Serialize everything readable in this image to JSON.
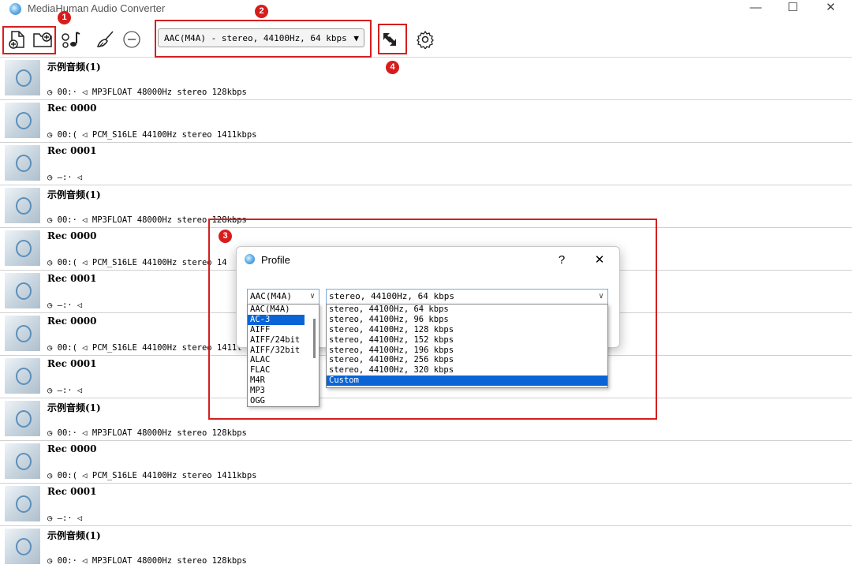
{
  "window": {
    "title": "MediaHuman Audio Converter",
    "minimize": "—",
    "maximize": "☐",
    "close": "✕"
  },
  "toolbar": {
    "profile_value": "AAC(M4A) - stereo, 44100Hz, 64 kbps",
    "icons": [
      "add-file-icon",
      "add-folder-icon",
      "music-note-icon",
      "broom-icon",
      "minus-circle-icon",
      "convert-icon",
      "gear-icon"
    ]
  },
  "markers": {
    "m1": "1",
    "m2": "2",
    "m3": "3",
    "m4": "4"
  },
  "files": [
    {
      "title": "示例音频(1)",
      "info": "◷ 00:· ◁ MP3FLOAT 48000Hz stereo 128kbps"
    },
    {
      "title": "Rec 0000",
      "info": "◷ 00:( ◁ PCM_S16LE 44100Hz stereo 1411kbps"
    },
    {
      "title": "Rec 0001",
      "info": "◷ —:· ◁"
    },
    {
      "title": "示例音频(1)",
      "info": "◷ 00:· ◁ MP3FLOAT 48000Hz stereo 128kbps"
    },
    {
      "title": "Rec 0000",
      "info": "◷ 00:( ◁ PCM_S16LE 44100Hz stereo 14"
    },
    {
      "title": "Rec 0001",
      "info": "◷ —:· ◁"
    },
    {
      "title": "Rec 0000",
      "info": "◷ 00:( ◁ PCM_S16LE 44100Hz stereo 1411l"
    },
    {
      "title": "Rec 0001",
      "info": "◷ —:· ◁"
    },
    {
      "title": "示例音频(1)",
      "info": "◷ 00:· ◁ MP3FLOAT 48000Hz stereo 128kbps"
    },
    {
      "title": "Rec 0000",
      "info": "◷ 00:( ◁ PCM_S16LE 44100Hz stereo 1411kbps"
    },
    {
      "title": "Rec 0001",
      "info": "◷ —:· ◁"
    },
    {
      "title": "示例音频(1)",
      "info": "◷ 00:· ◁ MP3FLOAT 48000Hz stereo 128kbps"
    }
  ],
  "dialog": {
    "title": "Profile",
    "help": "?",
    "close": "✕",
    "format_value": "AAC(M4A)",
    "quality_value": "stereo, 44100Hz, 64 kbps",
    "formats": [
      "AAC(M4A)",
      "AC-3",
      "AIFF",
      "AIFF/24bit",
      "AIFF/32bit",
      "ALAC",
      "FLAC",
      "M4R",
      "MP3",
      "OGG"
    ],
    "formats_selected": "AC-3",
    "qualities": [
      "stereo, 44100Hz, 64 kbps",
      "stereo, 44100Hz, 96 kbps",
      "stereo, 44100Hz, 128 kbps",
      "stereo, 44100Hz, 152 kbps",
      "stereo, 44100Hz, 196 kbps",
      "stereo, 44100Hz, 256 kbps",
      "stereo, 44100Hz, 320 kbps",
      "Custom"
    ],
    "qualities_selected": "Custom"
  }
}
